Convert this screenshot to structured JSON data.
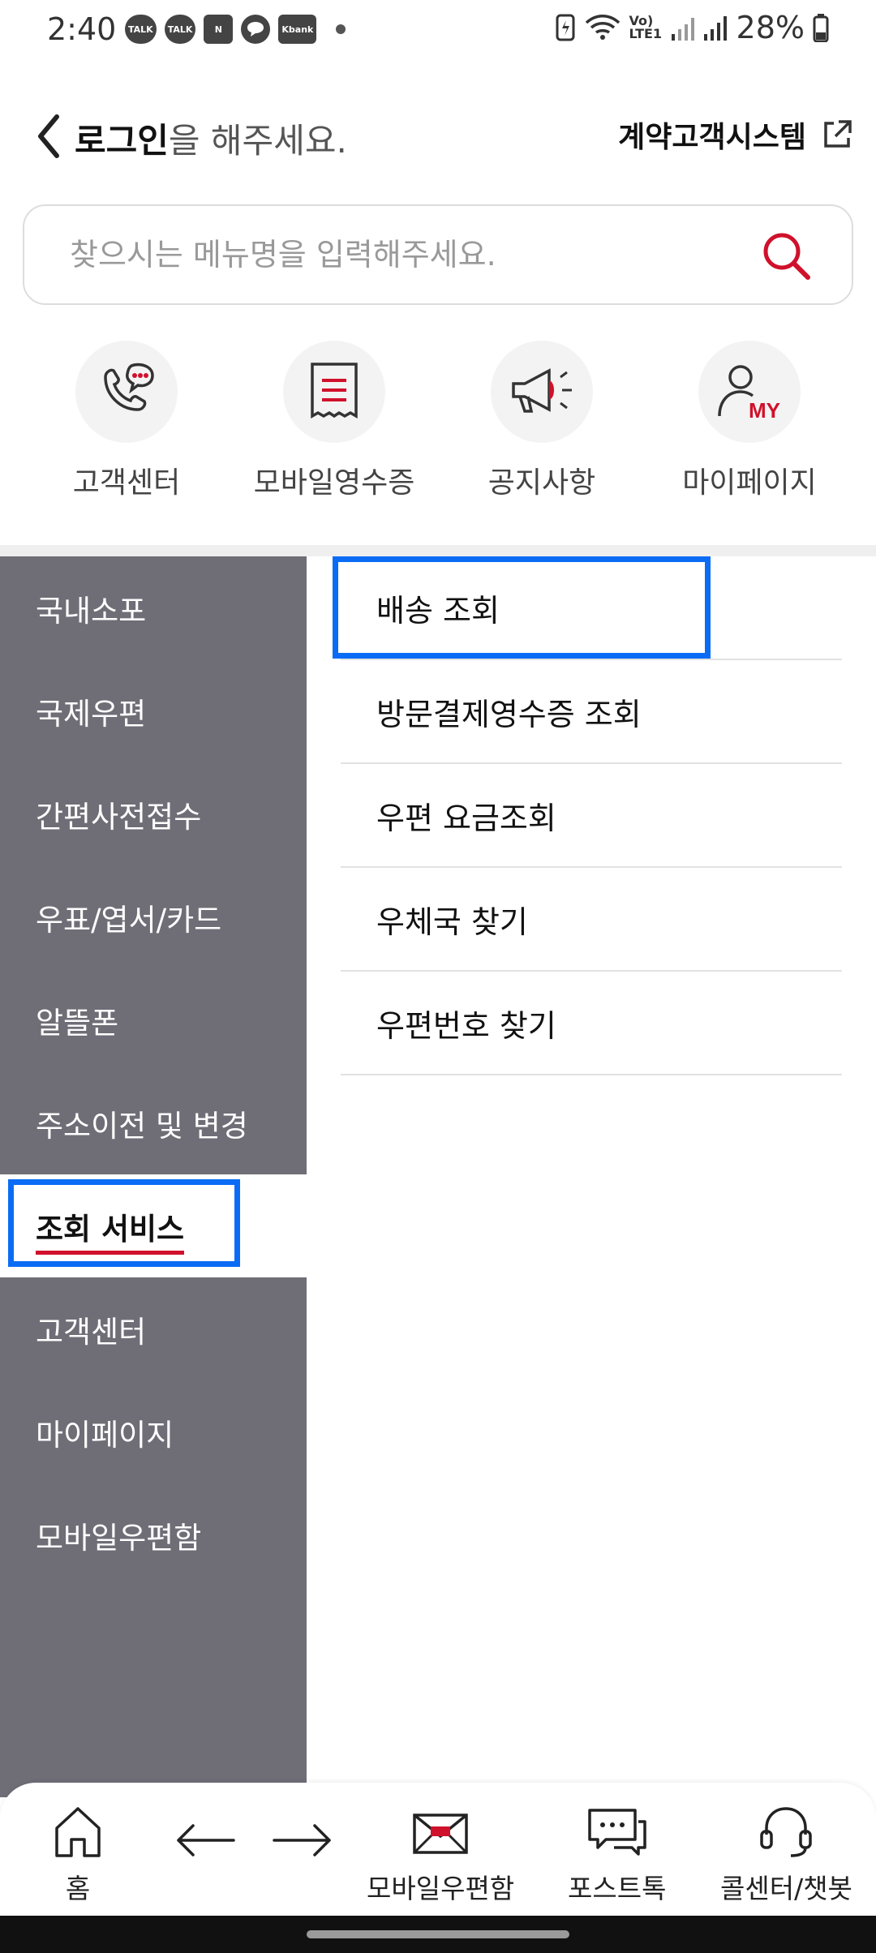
{
  "status_bar": {
    "time": "2:40",
    "notifications": [
      "TALK",
      "TALK",
      "N",
      "Kbank"
    ],
    "network": "Vo) LTE1",
    "battery": "28%"
  },
  "header": {
    "login_strong": "로그인",
    "login_rest": "을 해주세요.",
    "contract_link": "계약고객시스템"
  },
  "search": {
    "placeholder": "찾으시는 메뉴명을 입력해주세요."
  },
  "quick_menu": [
    {
      "label": "고객센터",
      "icon": "phone-chat-icon"
    },
    {
      "label": "모바일영수증",
      "icon": "receipt-icon"
    },
    {
      "label": "공지사항",
      "icon": "megaphone-icon"
    },
    {
      "label": "마이페이지",
      "icon": "my-user-icon"
    }
  ],
  "left_menu": [
    {
      "label": "국내소포",
      "active": false
    },
    {
      "label": "국제우편",
      "active": false
    },
    {
      "label": "간편사전접수",
      "active": false
    },
    {
      "label": "우표/엽서/카드",
      "active": false
    },
    {
      "label": "알뜰폰",
      "active": false
    },
    {
      "label": "주소이전 및 변경",
      "active": false
    },
    {
      "label": "조회 서비스",
      "active": true
    },
    {
      "label": "고객센터",
      "active": false
    },
    {
      "label": "마이페이지",
      "active": false
    },
    {
      "label": "모바일우편함",
      "active": false
    }
  ],
  "sub_menu": [
    {
      "label": "배송 조회"
    },
    {
      "label": "방문결제영수증 조회"
    },
    {
      "label": "우편 요금조회"
    },
    {
      "label": "우체국 찾기"
    },
    {
      "label": "우편번호 찾기"
    }
  ],
  "bottom_nav": {
    "home": "홈",
    "mailbox": "모바일우편함",
    "posttalk": "포스트톡",
    "callcenter": "콜센터/챗봇"
  },
  "colors": {
    "accent": "#d0112b",
    "left_menu_bg": "#6f6e77",
    "highlight": "#0a6cf5"
  }
}
